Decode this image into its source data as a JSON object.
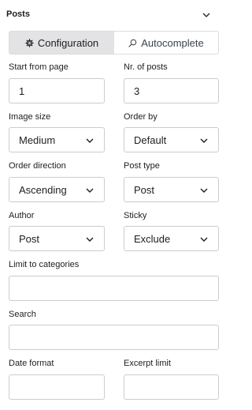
{
  "header": {
    "title": "Posts",
    "chevron_icon": "chevron-down-icon"
  },
  "tabs": [
    {
      "label": "Configuration",
      "icon": "gear-icon",
      "active": true
    },
    {
      "label": "Autocomplete",
      "icon": "search-icon",
      "active": false
    }
  ],
  "fields": {
    "start_from_page": {
      "label": "Start from page",
      "value": "1"
    },
    "nr_of_posts": {
      "label": "Nr. of posts",
      "value": "3"
    },
    "image_size": {
      "label": "Image size",
      "value": "Medium"
    },
    "order_by": {
      "label": "Order by",
      "value": "Default"
    },
    "order_direction": {
      "label": "Order direction",
      "value": "Ascending"
    },
    "post_type": {
      "label": "Post type",
      "value": "Post"
    },
    "author": {
      "label": "Author",
      "value": "Post"
    },
    "sticky": {
      "label": "Sticky",
      "value": "Exclude"
    },
    "limit_to_categories": {
      "label": "Limit to categories",
      "value": ""
    },
    "search": {
      "label": "Search",
      "value": ""
    },
    "date_format": {
      "label": "Date format",
      "value": ""
    },
    "excerpt_limit": {
      "label": "Excerpt limit",
      "value": ""
    }
  },
  "colors": {
    "active_tab_bg": "#e3e3e6",
    "border": "#ccccd0",
    "text": "#1e1e1e"
  }
}
